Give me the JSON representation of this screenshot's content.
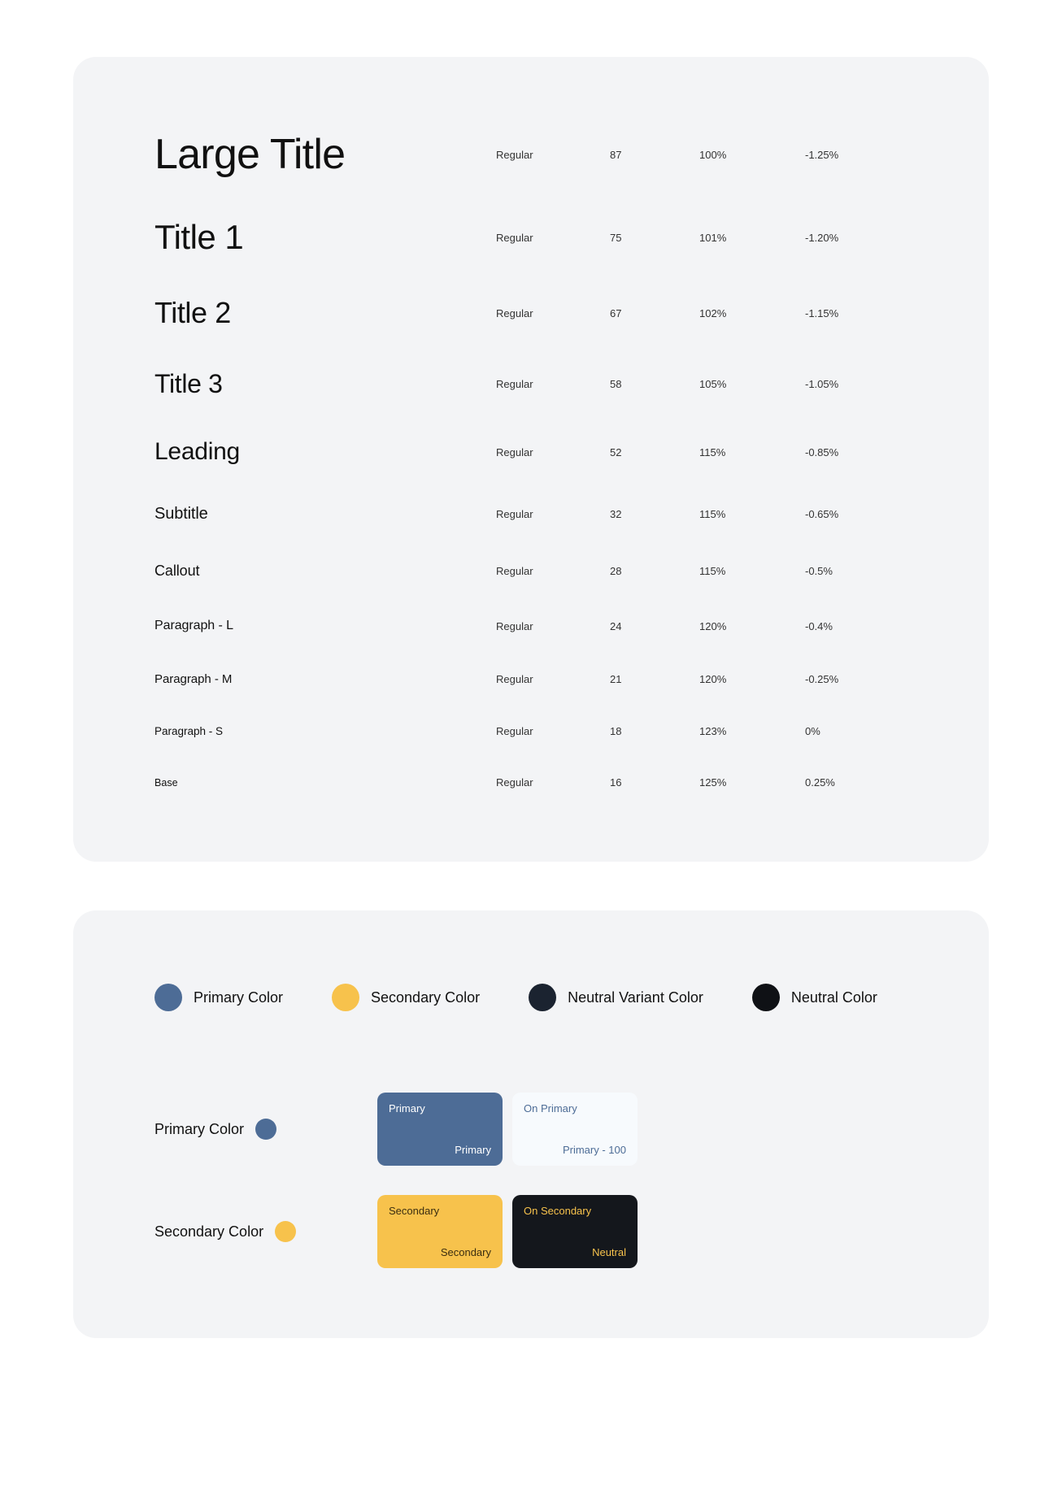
{
  "typography": {
    "rows": [
      {
        "name": "Large Title",
        "weight": "Regular",
        "size": "87",
        "line": "100%",
        "tracking": "-1.25%",
        "class": "sz-large-title"
      },
      {
        "name": "Title 1",
        "weight": "Regular",
        "size": "75",
        "line": "101%",
        "tracking": "-1.20%",
        "class": "sz-title1"
      },
      {
        "name": "Title 2",
        "weight": "Regular",
        "size": "67",
        "line": "102%",
        "tracking": "-1.15%",
        "class": "sz-title2"
      },
      {
        "name": "Title 3",
        "weight": "Regular",
        "size": "58",
        "line": "105%",
        "tracking": "-1.05%",
        "class": "sz-title3"
      },
      {
        "name": "Leading",
        "weight": "Regular",
        "size": "52",
        "line": "115%",
        "tracking": "-0.85%",
        "class": "sz-leading"
      },
      {
        "name": "Subtitle",
        "weight": "Regular",
        "size": "32",
        "line": "115%",
        "tracking": "-0.65%",
        "class": "sz-subtitle"
      },
      {
        "name": "Callout",
        "weight": "Regular",
        "size": "28",
        "line": "115%",
        "tracking": "-0.5%",
        "class": "sz-callout"
      },
      {
        "name": "Paragraph - L",
        "weight": "Regular",
        "size": "24",
        "line": "120%",
        "tracking": "-0.4%",
        "class": "sz-p-l"
      },
      {
        "name": "Paragraph - M",
        "weight": "Regular",
        "size": "21",
        "line": "120%",
        "tracking": "-0.25%",
        "class": "sz-p-m"
      },
      {
        "name": "Paragraph - S",
        "weight": "Regular",
        "size": "18",
        "line": "123%",
        "tracking": "0%",
        "class": "sz-p-s"
      },
      {
        "name": "Base",
        "weight": "Regular",
        "size": "16",
        "line": "125%",
        "tracking": "0.25%",
        "class": "sz-base"
      }
    ]
  },
  "colors": {
    "legend": [
      {
        "label": "Primary Color",
        "hex": "#4d6c96"
      },
      {
        "label": "Secondary Color",
        "hex": "#f7c24c"
      },
      {
        "label": "Neutral Variant Color",
        "hex": "#1b2330"
      },
      {
        "label": "Neutral Color",
        "hex": "#0f1115"
      }
    ],
    "sections": [
      {
        "label": "Primary Color",
        "swatch": "#4d6c96",
        "chips": [
          {
            "bg": "#4d6c96",
            "fg": "#ffffff",
            "top": "Primary",
            "bot": "Primary"
          },
          {
            "bg": "#f7fafd",
            "fg": "#4d6c96",
            "top": "On Primary",
            "bot": "Primary - 100"
          }
        ]
      },
      {
        "label": "Secondary Color",
        "swatch": "#f7c24c",
        "chips": [
          {
            "bg": "#f7c24c",
            "fg": "#3a2d10",
            "top": "Secondary",
            "bot": "Secondary"
          },
          {
            "bg": "#14171c",
            "fg": "#f7c24c",
            "top": "On Secondary",
            "bot": "Neutral"
          }
        ]
      }
    ]
  }
}
